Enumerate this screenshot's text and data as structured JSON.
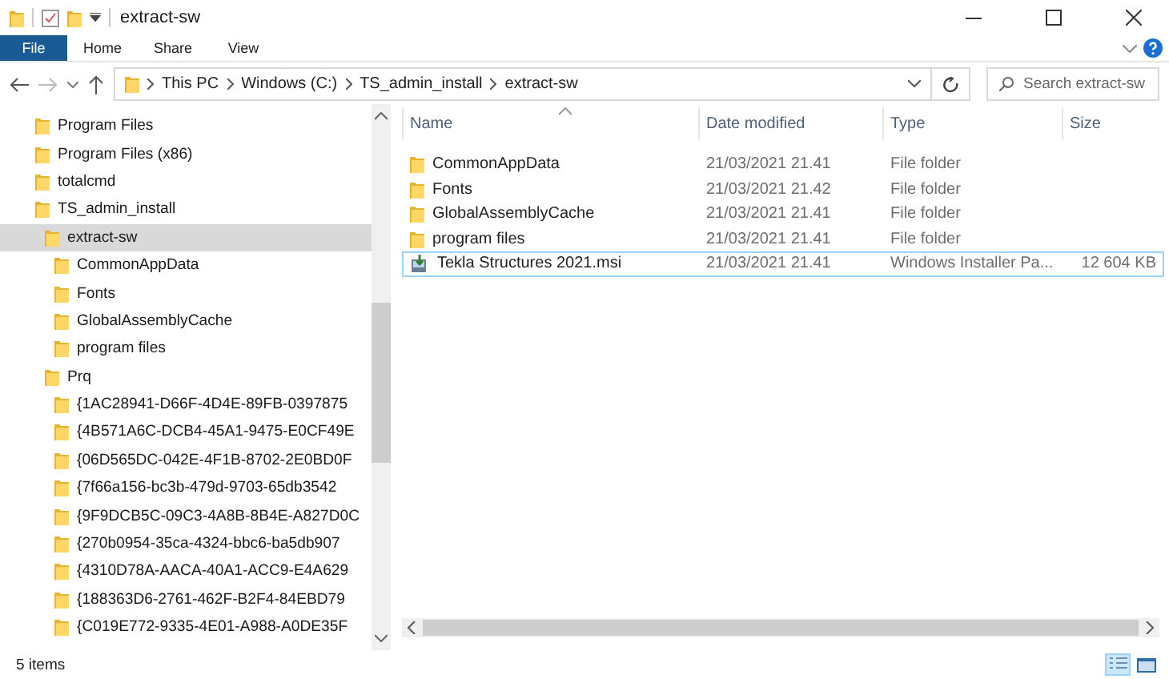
{
  "window": {
    "title": "extract-sw"
  },
  "ribbon": {
    "file_button": "File",
    "tabs": [
      "Home",
      "Share",
      "View"
    ]
  },
  "address_bar": {
    "breadcrumbs": [
      "This PC",
      "Windows (C:)",
      "TS_admin_install",
      "extract-sw"
    ]
  },
  "search": {
    "placeholder": "Search extract-sw"
  },
  "navigation_tree": [
    {
      "label": "Program Files",
      "selected": false
    },
    {
      "label": "Program Files (x86)",
      "selected": false
    },
    {
      "label": "totalcmd",
      "selected": false
    },
    {
      "label": "TS_admin_install",
      "selected": false,
      "children": [
        {
          "label": "extract-sw",
          "selected": true,
          "children": [
            {
              "label": "CommonAppData",
              "selected": false
            },
            {
              "label": "Fonts",
              "selected": false
            },
            {
              "label": "GlobalAssemblyCache",
              "selected": false
            },
            {
              "label": "program files",
              "selected": false
            }
          ]
        },
        {
          "label": "Prq",
          "selected": false,
          "children": [
            {
              "label": "{1AC28941-D66F-4D4E-89FB-0397875",
              "selected": false
            },
            {
              "label": "{4B571A6C-DCB4-45A1-9475-E0CF49E",
              "selected": false
            },
            {
              "label": "{06D565DC-042E-4F1B-8702-2E0BD0F",
              "selected": false
            },
            {
              "label": "{7f66a156-bc3b-479d-9703-65db3542",
              "selected": false
            },
            {
              "label": "{9F9DCB5C-09C3-4A8B-8B4E-A827D0C",
              "selected": false
            },
            {
              "label": "{270b0954-35ca-4324-bbc6-ba5db907",
              "selected": false
            },
            {
              "label": "{4310D78A-AACA-40A1-ACC9-E4A629",
              "selected": false
            },
            {
              "label": "{188363D6-2761-462F-B2F4-84EBD79",
              "selected": false
            },
            {
              "label": "{C019E772-9335-4E01-A988-A0DE35F",
              "selected": false
            }
          ]
        }
      ]
    }
  ],
  "file_list": {
    "columns": [
      "Name",
      "Date modified",
      "Type",
      "Size"
    ],
    "rows": [
      {
        "kind": "folder",
        "name": "CommonAppData",
        "date": "21/03/2021 21.41",
        "type": "File folder",
        "focused": false
      },
      {
        "kind": "folder",
        "name": "Fonts",
        "date": "21/03/2021 21.42",
        "type": "File folder",
        "focused": false
      },
      {
        "kind": "folder",
        "name": "GlobalAssemblyCache",
        "date": "21/03/2021 21.41",
        "type": "File folder",
        "focused": false
      },
      {
        "kind": "folder",
        "name": "program files",
        "date": "21/03/2021 21.41",
        "type": "File folder",
        "focused": false
      },
      {
        "kind": "installer",
        "name": "Tekla Structures 2021.msi",
        "date": "21/03/2021 21.41",
        "type": "Windows Installer Pa...",
        "size": "12 604 KB",
        "focused": true
      }
    ]
  },
  "status_bar": {
    "item_count": "5 items",
    "view_buttons": [
      {
        "kind": "details",
        "selected": true
      },
      {
        "kind": "thumbnails",
        "selected": false
      }
    ]
  }
}
